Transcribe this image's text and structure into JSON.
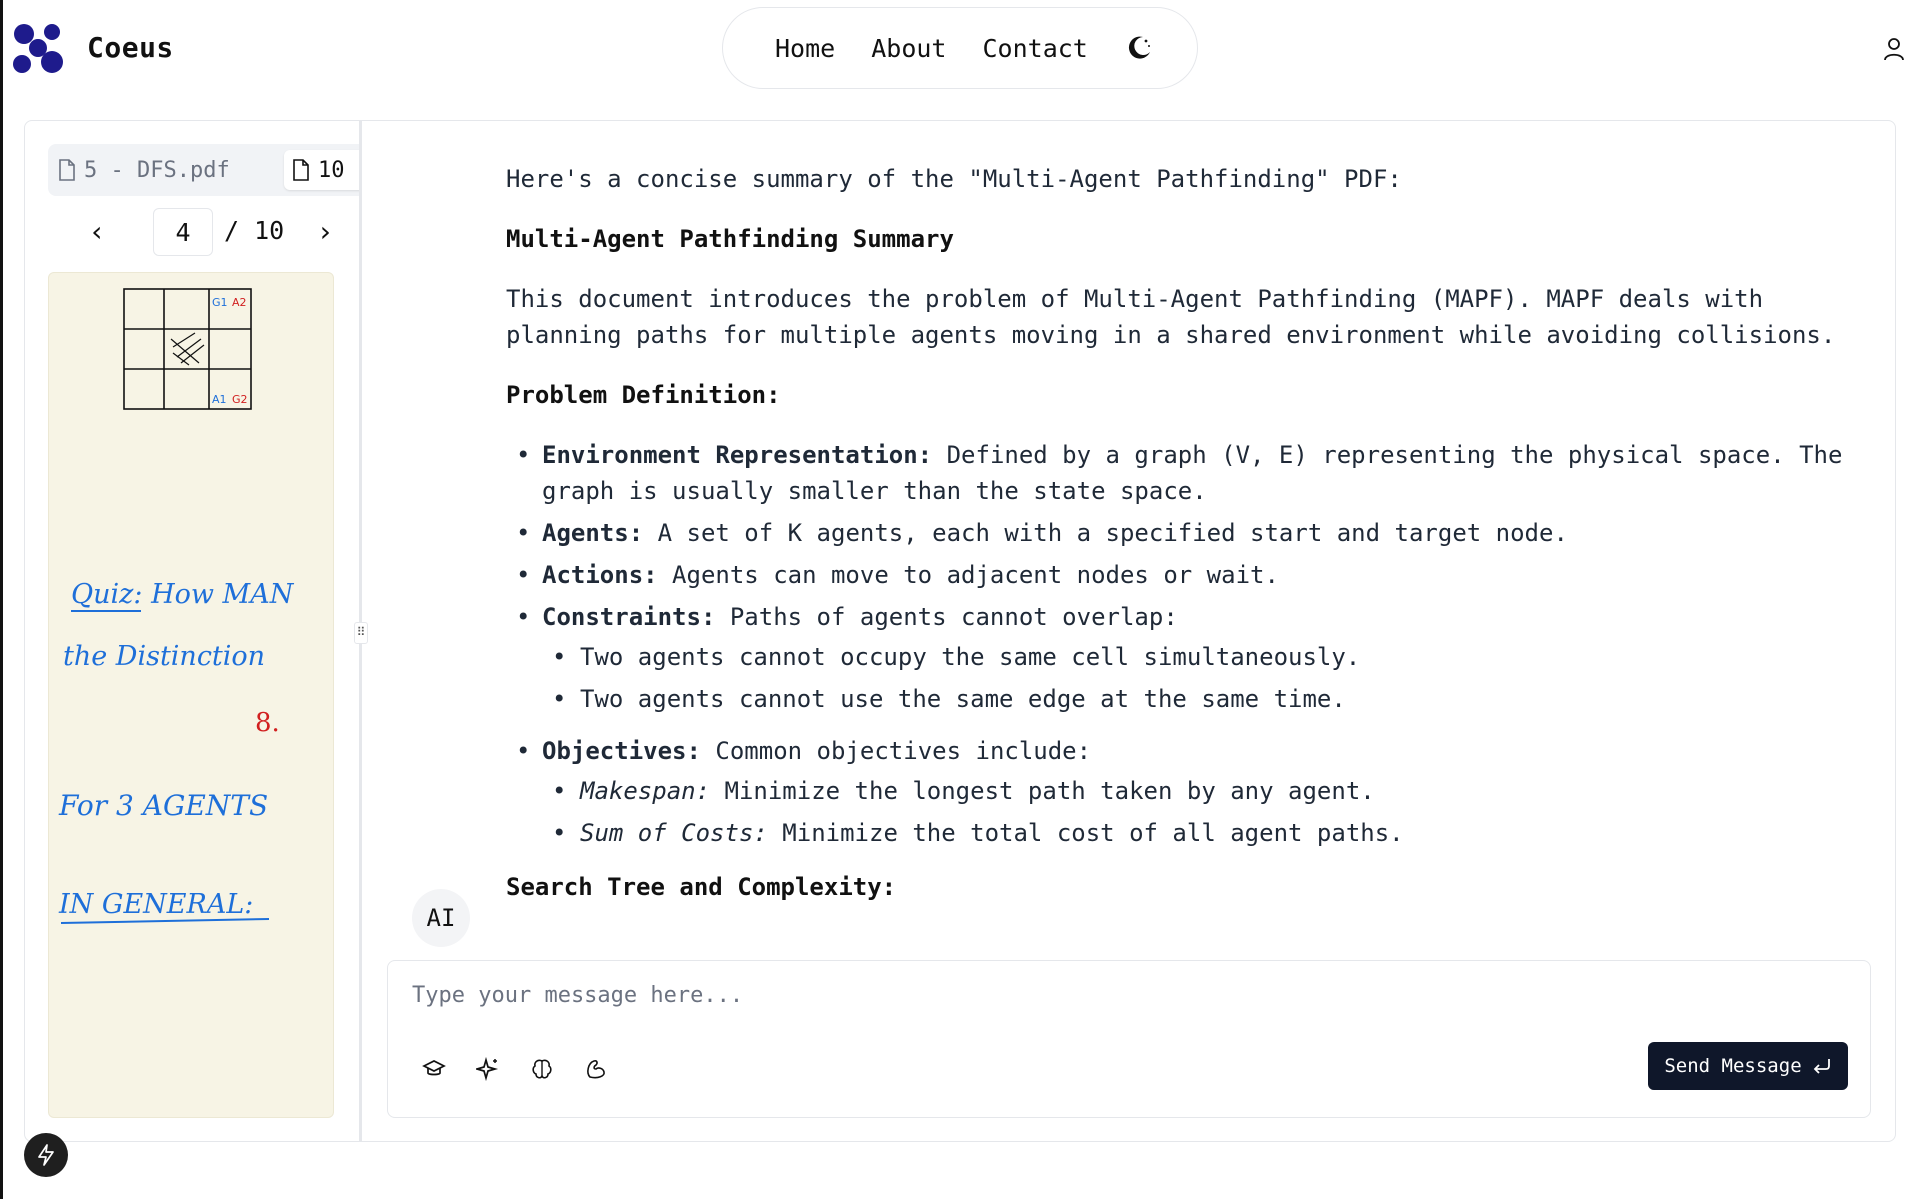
{
  "app": {
    "brand": "Coeus"
  },
  "nav": {
    "home": "Home",
    "about": "About",
    "contact": "Contact"
  },
  "icons": {
    "logo": "logo-icon",
    "theme": "moon-icon",
    "user": "user-icon",
    "file": "file-icon",
    "prev": "chevron-left-icon",
    "next": "chevron-right-icon",
    "tools": [
      "graduation-cap-icon",
      "sparkles-icon",
      "brain-icon",
      "biceps-icon"
    ],
    "send": "enter-icon",
    "bolt": "lightning-icon"
  },
  "colors": {
    "accent": "#1e1b8c",
    "send_bg": "#0f172a",
    "pdf_bg": "#f7f4e5",
    "ink_blue": "#1e6fd9",
    "ink_red": "#d11f1f"
  },
  "pdf": {
    "tabs": [
      "5 - DFS.pdf",
      "10 - "
    ],
    "current_page": "4",
    "total": "/ 10",
    "handwriting": {
      "grid_labels": [
        "G1",
        "A2",
        "A1",
        "G2"
      ],
      "quiz_line1": "Quiz: How MAN",
      "quiz_line2": "the Distinction",
      "quiz_num": "8.",
      "for3": "For 3 AGENTS",
      "general": "IN GENERAL:"
    }
  },
  "chat": {
    "intro": "Here's a concise summary of the \"Multi-Agent Pathfinding\" PDF:",
    "title": "Multi-Agent Pathfinding Summary",
    "paragraph": "This document introduces the problem of Multi-Agent Pathfinding (MAPF). MAPF deals with planning paths for multiple agents moving in a shared environment while avoiding collisions.",
    "problem_heading": "Problem Definition:",
    "items": [
      {
        "term": "Environment Representation:",
        "text": " Defined by a graph (V, E) representing the physical space. The graph is usually smaller than the state space."
      },
      {
        "term": "Agents:",
        "text": " A set of K agents, each with a specified start and target node."
      },
      {
        "term": "Actions:",
        "text": " Agents can move to adjacent nodes or wait."
      },
      {
        "term": "Constraints:",
        "text": " Paths of agents cannot overlap:"
      }
    ],
    "constraints": [
      "Two agents cannot occupy the same cell simultaneously.",
      "Two agents cannot use the same edge at the same time."
    ],
    "objectives": {
      "term": "Objectives:",
      "text": " Common objectives include:"
    },
    "objective_items": [
      {
        "term": "Makespan:",
        "text": " Minimize the longest path taken by any agent."
      },
      {
        "term": "Sum of Costs:",
        "text": " Minimize the total cost of all agent paths."
      }
    ],
    "next_heading": "Search Tree and Complexity:",
    "avatar": "AI"
  },
  "composer": {
    "placeholder": "Type your message here...",
    "send": "Send Message"
  }
}
